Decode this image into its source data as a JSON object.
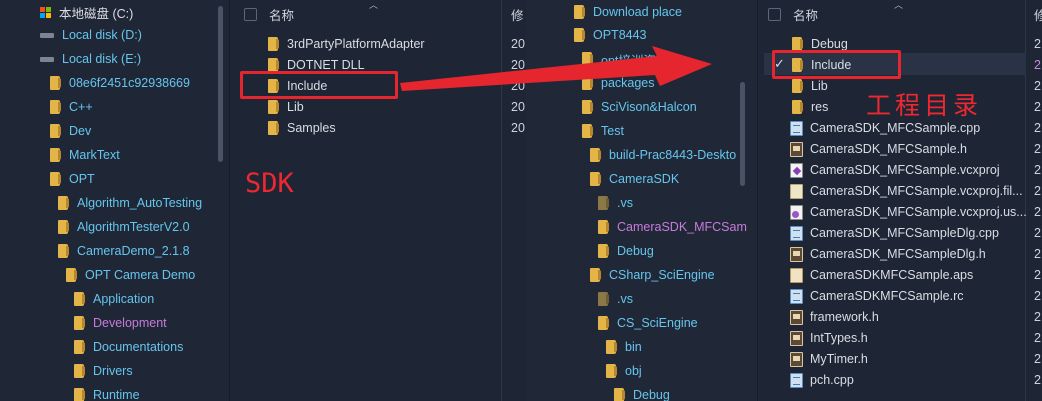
{
  "left_nav": {
    "items": [
      {
        "label": "本地磁盘 (C:)",
        "icon": "windows-drive-icon"
      },
      {
        "label": "Local disk (D:)",
        "icon": "drive-icon"
      },
      {
        "label": "Local disk (E:)",
        "icon": "drive-icon"
      },
      {
        "label": "08e6f2451c92938669",
        "icon": "folder-icon"
      },
      {
        "label": "C++",
        "icon": "folder-icon"
      },
      {
        "label": "Dev",
        "icon": "folder-icon"
      },
      {
        "label": "MarkText",
        "icon": "folder-icon"
      },
      {
        "label": "OPT",
        "icon": "folder-icon"
      },
      {
        "label": "Algorithm_AutoTesting",
        "icon": "folder-icon"
      },
      {
        "label": "AlgorithmTesterV2.0",
        "icon": "folder-icon"
      },
      {
        "label": "CameraDemo_2.1.8",
        "icon": "folder-icon"
      },
      {
        "label": "OPT Camera Demo",
        "icon": "folder-icon"
      },
      {
        "label": "Application",
        "icon": "folder-icon"
      },
      {
        "label": "Development",
        "icon": "folder-icon",
        "state": "selected"
      },
      {
        "label": "Documentations",
        "icon": "folder-icon"
      },
      {
        "label": "Drivers",
        "icon": "folder-icon"
      },
      {
        "label": "Runtime",
        "icon": "folder-icon"
      }
    ]
  },
  "sdk_list": {
    "header_name": "名称",
    "header_modified": "修",
    "rows": [
      {
        "name": "3rdPartyPlatformAdapter",
        "date": "20"
      },
      {
        "name": "DOTNET DLL",
        "date": "20"
      },
      {
        "name": "Include",
        "date": "20"
      },
      {
        "name": "Lib",
        "date": "20"
      },
      {
        "name": "Samples",
        "date": "20"
      }
    ]
  },
  "right_nav": {
    "items": [
      {
        "label": "Download place"
      },
      {
        "label": "OPT8443"
      },
      {
        "label": "opt培训资料"
      },
      {
        "label": "packages"
      },
      {
        "label": "SciVison&Halcon"
      },
      {
        "label": "Test"
      },
      {
        "label": "build-Prac8443-Deskto"
      },
      {
        "label": "CameraSDK"
      },
      {
        "label": ".vs"
      },
      {
        "label": "CameraSDK_MFCSam",
        "state": "selected"
      },
      {
        "label": "Debug"
      },
      {
        "label": "CSharp_SciEngine"
      },
      {
        "label": ".vs"
      },
      {
        "label": "CS_SciEngine"
      },
      {
        "label": "bin"
      },
      {
        "label": "obj"
      },
      {
        "label": "Debug"
      }
    ]
  },
  "project_list": {
    "header_name": "名称",
    "header_modified": "修",
    "rows": [
      {
        "name": "Debug",
        "date": "2",
        "type": "folder"
      },
      {
        "name": "Include",
        "date": "2",
        "type": "folder",
        "selected": true
      },
      {
        "name": "Lib",
        "date": "2",
        "type": "folder"
      },
      {
        "name": "res",
        "date": "2",
        "type": "folder"
      },
      {
        "name": "CameraSDK_MFCSample.cpp",
        "date": "2",
        "type": "cpp"
      },
      {
        "name": "CameraSDK_MFCSample.h",
        "date": "2",
        "type": "h"
      },
      {
        "name": "CameraSDK_MFCSample.vcxproj",
        "date": "2",
        "type": "proj"
      },
      {
        "name": "CameraSDK_MFCSample.vcxproj.fil...",
        "date": "2",
        "type": "txt"
      },
      {
        "name": "CameraSDK_MFCSample.vcxproj.us...",
        "date": "2",
        "type": "user"
      },
      {
        "name": "CameraSDK_MFCSampleDlg.cpp",
        "date": "2",
        "type": "cpp"
      },
      {
        "name": "CameraSDK_MFCSampleDlg.h",
        "date": "2",
        "type": "h"
      },
      {
        "name": "CameraSDKMFCSample.aps",
        "date": "2",
        "type": "aps"
      },
      {
        "name": "CameraSDKMFCSample.rc",
        "date": "2",
        "type": "cpp"
      },
      {
        "name": "framework.h",
        "date": "2",
        "type": "h"
      },
      {
        "name": "IntTypes.h",
        "date": "2",
        "type": "h"
      },
      {
        "name": "MyTimer.h",
        "date": "2",
        "type": "h"
      },
      {
        "name": "pch.cpp",
        "date": "2",
        "type": "cpp"
      }
    ]
  },
  "annotations": {
    "sdk_label": "SDK",
    "project_label": "工程目录",
    "color": "#e5262f"
  }
}
